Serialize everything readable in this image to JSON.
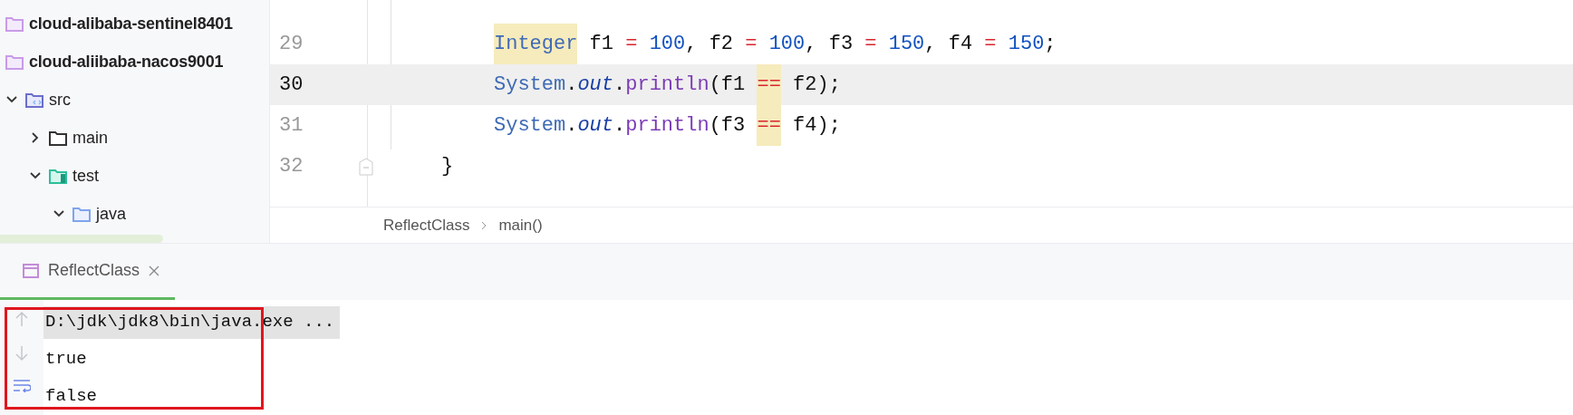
{
  "project_tree": [
    {
      "label": "cloud-alibaba-sentinel8401",
      "kind": "module"
    },
    {
      "label": "cloud-aliibaba-nacos9001",
      "kind": "module"
    },
    {
      "label": "src",
      "kind": "source",
      "expanded": true,
      "children": [
        {
          "label": "main",
          "kind": "folder",
          "expanded": false
        },
        {
          "label": "test",
          "kind": "test",
          "expanded": true,
          "children": [
            {
              "label": "java",
              "kind": "java",
              "expanded": true
            }
          ]
        }
      ]
    }
  ],
  "editor": {
    "lines": [
      {
        "number": "29",
        "current": false,
        "tokens": [
          {
            "text": "Integer",
            "kind": "type",
            "highlighted": true
          },
          {
            "text": " f1 ",
            "kind": "plain"
          },
          {
            "text": "=",
            "kind": "op"
          },
          {
            "text": " 100",
            "kind": "num"
          },
          {
            "text": ", f2 ",
            "kind": "plain"
          },
          {
            "text": "=",
            "kind": "op"
          },
          {
            "text": " 100",
            "kind": "num"
          },
          {
            "text": ", f3 ",
            "kind": "plain"
          },
          {
            "text": "=",
            "kind": "op"
          },
          {
            "text": " 150",
            "kind": "num"
          },
          {
            "text": ", f4 ",
            "kind": "plain"
          },
          {
            "text": "=",
            "kind": "op"
          },
          {
            "text": " 150",
            "kind": "num"
          },
          {
            "text": ";",
            "kind": "plain"
          }
        ]
      },
      {
        "number": "30",
        "current": true,
        "tokens": [
          {
            "text": "System",
            "kind": "type"
          },
          {
            "text": ".",
            "kind": "plain"
          },
          {
            "text": "out",
            "kind": "field"
          },
          {
            "text": ".",
            "kind": "plain"
          },
          {
            "text": "println",
            "kind": "method"
          },
          {
            "text": "(f1 ",
            "kind": "plain"
          },
          {
            "text": "==",
            "kind": "op",
            "highlighted": true
          },
          {
            "text": " f2);",
            "kind": "plain"
          }
        ]
      },
      {
        "number": "31",
        "current": false,
        "tokens": [
          {
            "text": "System",
            "kind": "type"
          },
          {
            "text": ".",
            "kind": "plain"
          },
          {
            "text": "out",
            "kind": "field"
          },
          {
            "text": ".",
            "kind": "plain"
          },
          {
            "text": "println",
            "kind": "method"
          },
          {
            "text": "(f3 ",
            "kind": "plain"
          },
          {
            "text": "==",
            "kind": "op",
            "highlighted": true
          },
          {
            "text": " f4);",
            "kind": "plain"
          }
        ]
      },
      {
        "number": "32",
        "current": false,
        "fold": true,
        "tokens": [
          {
            "text": "}",
            "kind": "plain"
          }
        ]
      }
    ],
    "breadcrumbs": [
      "ReflectClass",
      "main()"
    ]
  },
  "run_panel": {
    "tabs": [
      {
        "label": "ReflectClass",
        "selected": true
      }
    ],
    "console": [
      {
        "text": "D:\\jdk\\jdk8\\bin\\java.exe ...",
        "highlighted": true
      },
      {
        "text": "true",
        "highlighted": false
      },
      {
        "text": "false",
        "highlighted": false
      }
    ]
  }
}
